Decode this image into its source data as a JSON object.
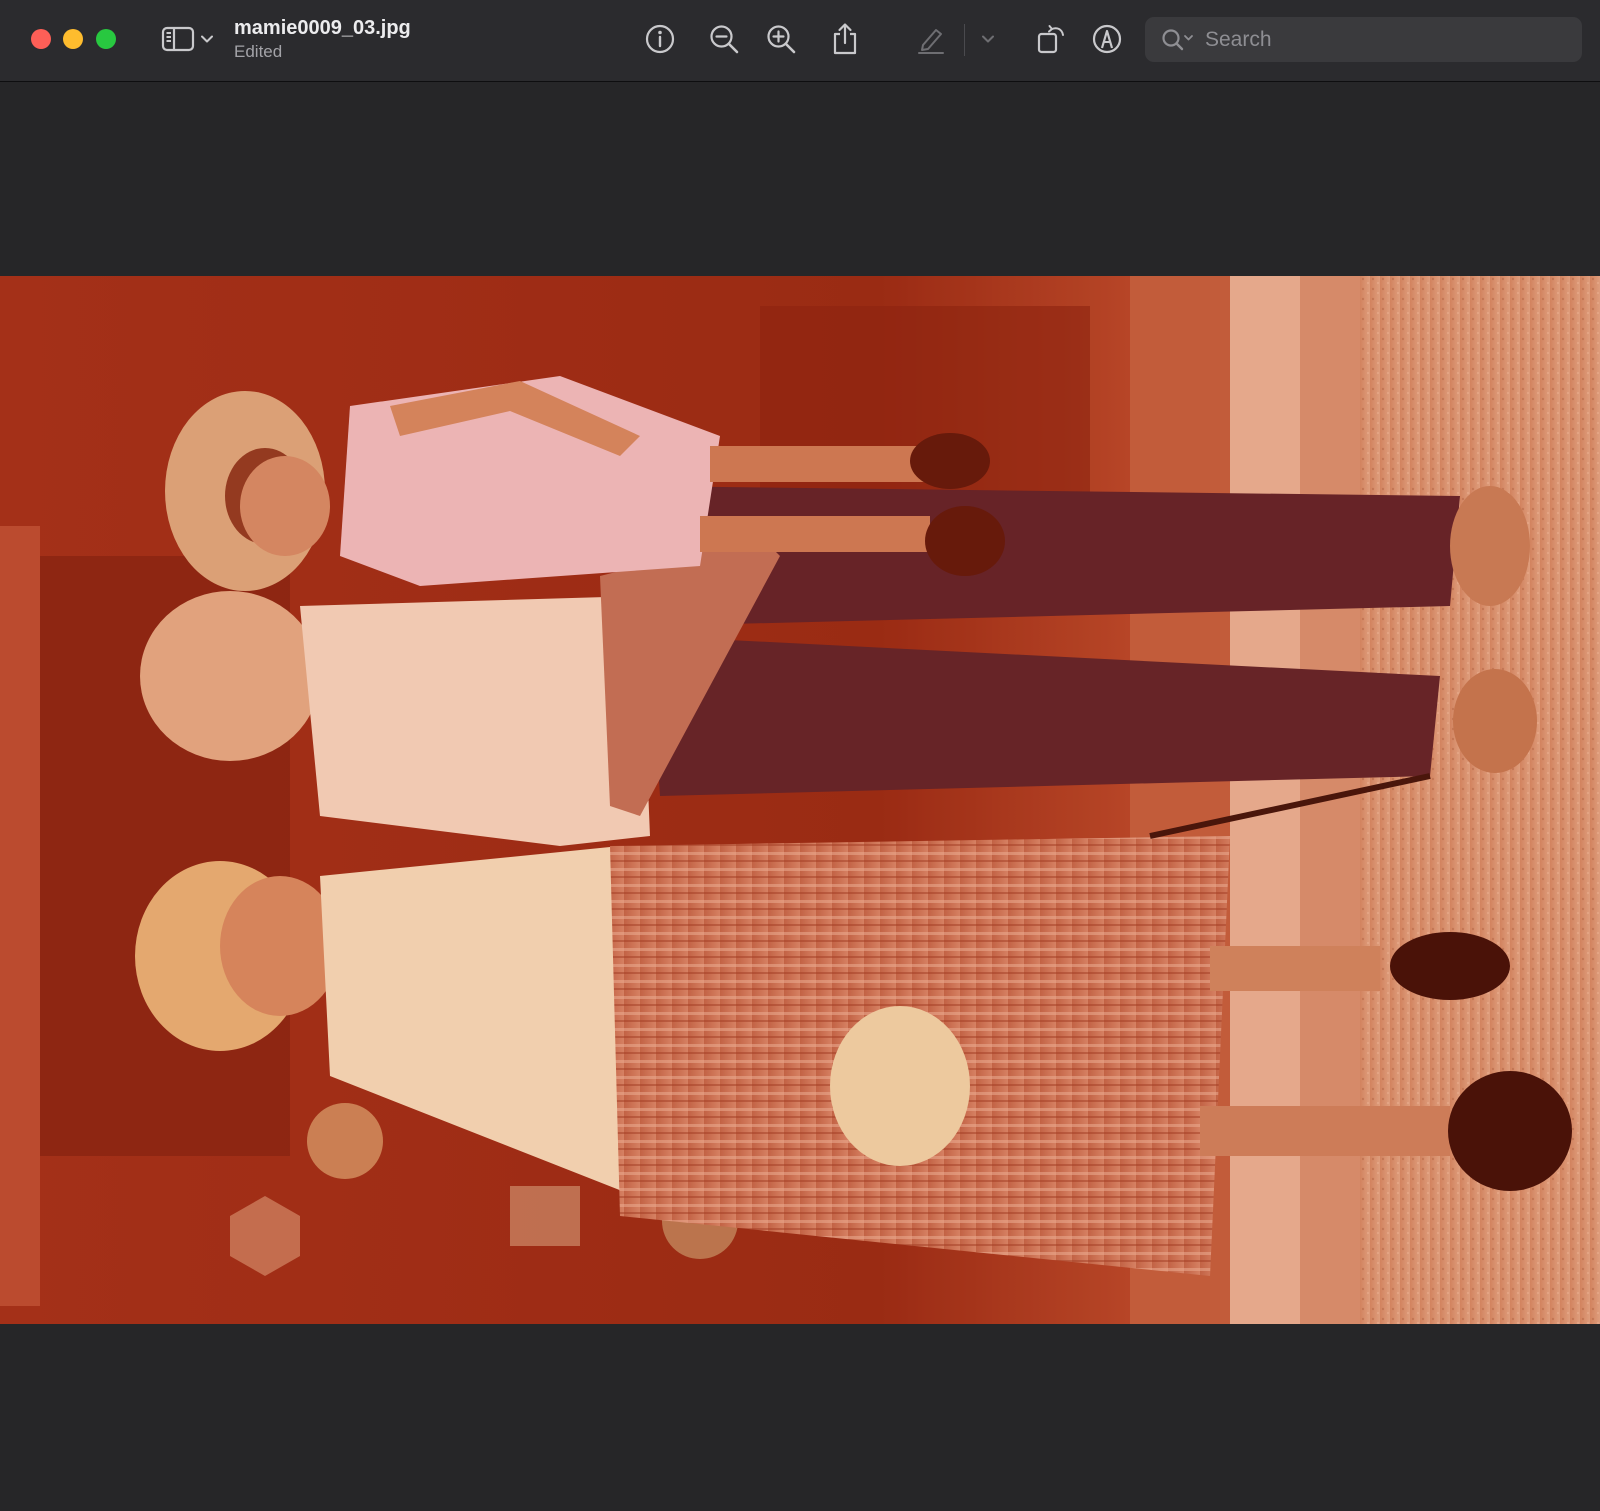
{
  "window": {
    "file_name": "mamie0009_03.jpg",
    "file_status": "Edited"
  },
  "toolbar": {
    "icons": [
      "sidebar-icon",
      "chevron-down-icon",
      "info-icon",
      "zoom-out-icon",
      "zoom-in-icon",
      "share-icon",
      "highlight-pen-icon",
      "chevron-down-icon",
      "rotate-icon",
      "markup-icon",
      "search-icon"
    ]
  },
  "search": {
    "placeholder": "Search",
    "value": ""
  },
  "photo": {
    "description_tone": "sepia-red",
    "colors": {
      "background_dark": "#8f2411",
      "warm_light": "#e9a47c",
      "pavement": "#d89a78"
    }
  },
  "colors": {
    "toolbar_bg": "#2b2b2e",
    "canvas_bg": "#262628",
    "close": "#fe5f57",
    "minimize": "#febc2e",
    "maximize": "#28c840"
  }
}
